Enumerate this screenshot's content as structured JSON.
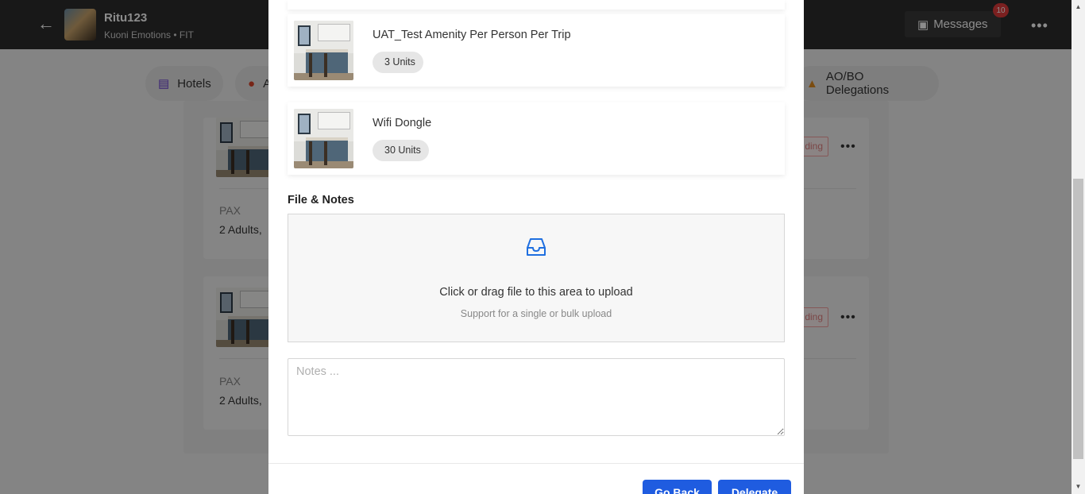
{
  "header": {
    "trip_name": "Ritu123",
    "trip_sub": "Kuoni Emotions • FIT",
    "messages_label": "Messages",
    "messages_count": "10"
  },
  "tabs": [
    {
      "label": "Hotels",
      "icon": "bed-icon"
    },
    {
      "label": "A",
      "icon": "apple-icon"
    },
    {
      "label": "AO/BO Delegations",
      "icon": "car-icon"
    }
  ],
  "background_cards": [
    {
      "pax_label": "PAX",
      "pax_value": "2 Adults,",
      "status": "ding"
    },
    {
      "pax_label": "PAX",
      "pax_value": "2 Adults,",
      "status": "ding"
    }
  ],
  "modal": {
    "amenities": [
      {
        "name": "UAT_Test Amenity Per Person Per Trip",
        "units": "3 Units"
      },
      {
        "name": "Wifi Dongle",
        "units": "30 Units"
      }
    ],
    "files_title": "File & Notes",
    "upload_title": "Click or drag file to this area to upload",
    "upload_hint": "Support for a single or bulk upload",
    "notes_placeholder": "Notes ...",
    "go_back_label": "Go Back",
    "delegate_label": "Delegate"
  },
  "colors": {
    "primary": "#1f5ce0",
    "badge": "#e03b3b",
    "topbar": "#2c2c2c"
  }
}
